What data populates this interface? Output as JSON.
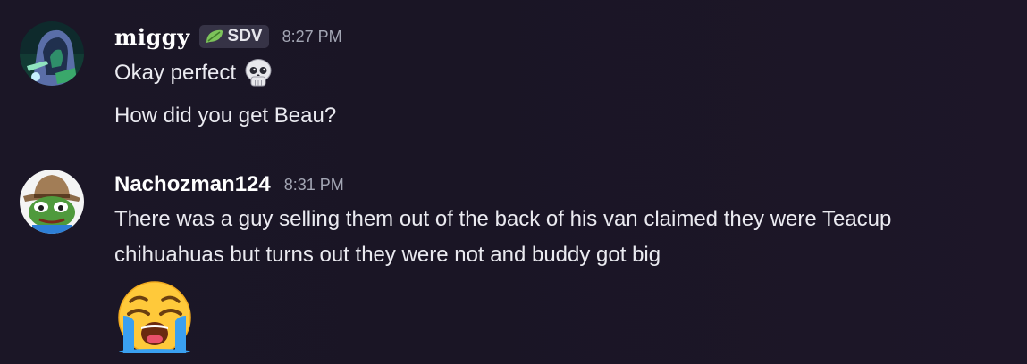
{
  "messages": [
    {
      "username": "miggy",
      "tag": "SDV",
      "tag_icon": "leaf-icon",
      "timestamp": "8:27 PM",
      "avatar": "hooded-figure-avatar",
      "lines": [
        "Okay perfect",
        "How did you get Beau?"
      ],
      "emoji": "skull-emoji"
    },
    {
      "username": "Nachozman124",
      "timestamp": "8:31 PM",
      "avatar": "cowboy-frog-avatar",
      "lines": [
        "There was a guy selling them out of the back of his van claimed they were Teacup",
        "chihuahuas but turns out they were not and buddy got big"
      ],
      "emoji": "loudly-crying-face-emoji"
    }
  ],
  "colors": {
    "background": "#1b1626",
    "tag_background": "#363346",
    "timestamp": "#a3a6b4",
    "text": "#eaeaf0"
  }
}
